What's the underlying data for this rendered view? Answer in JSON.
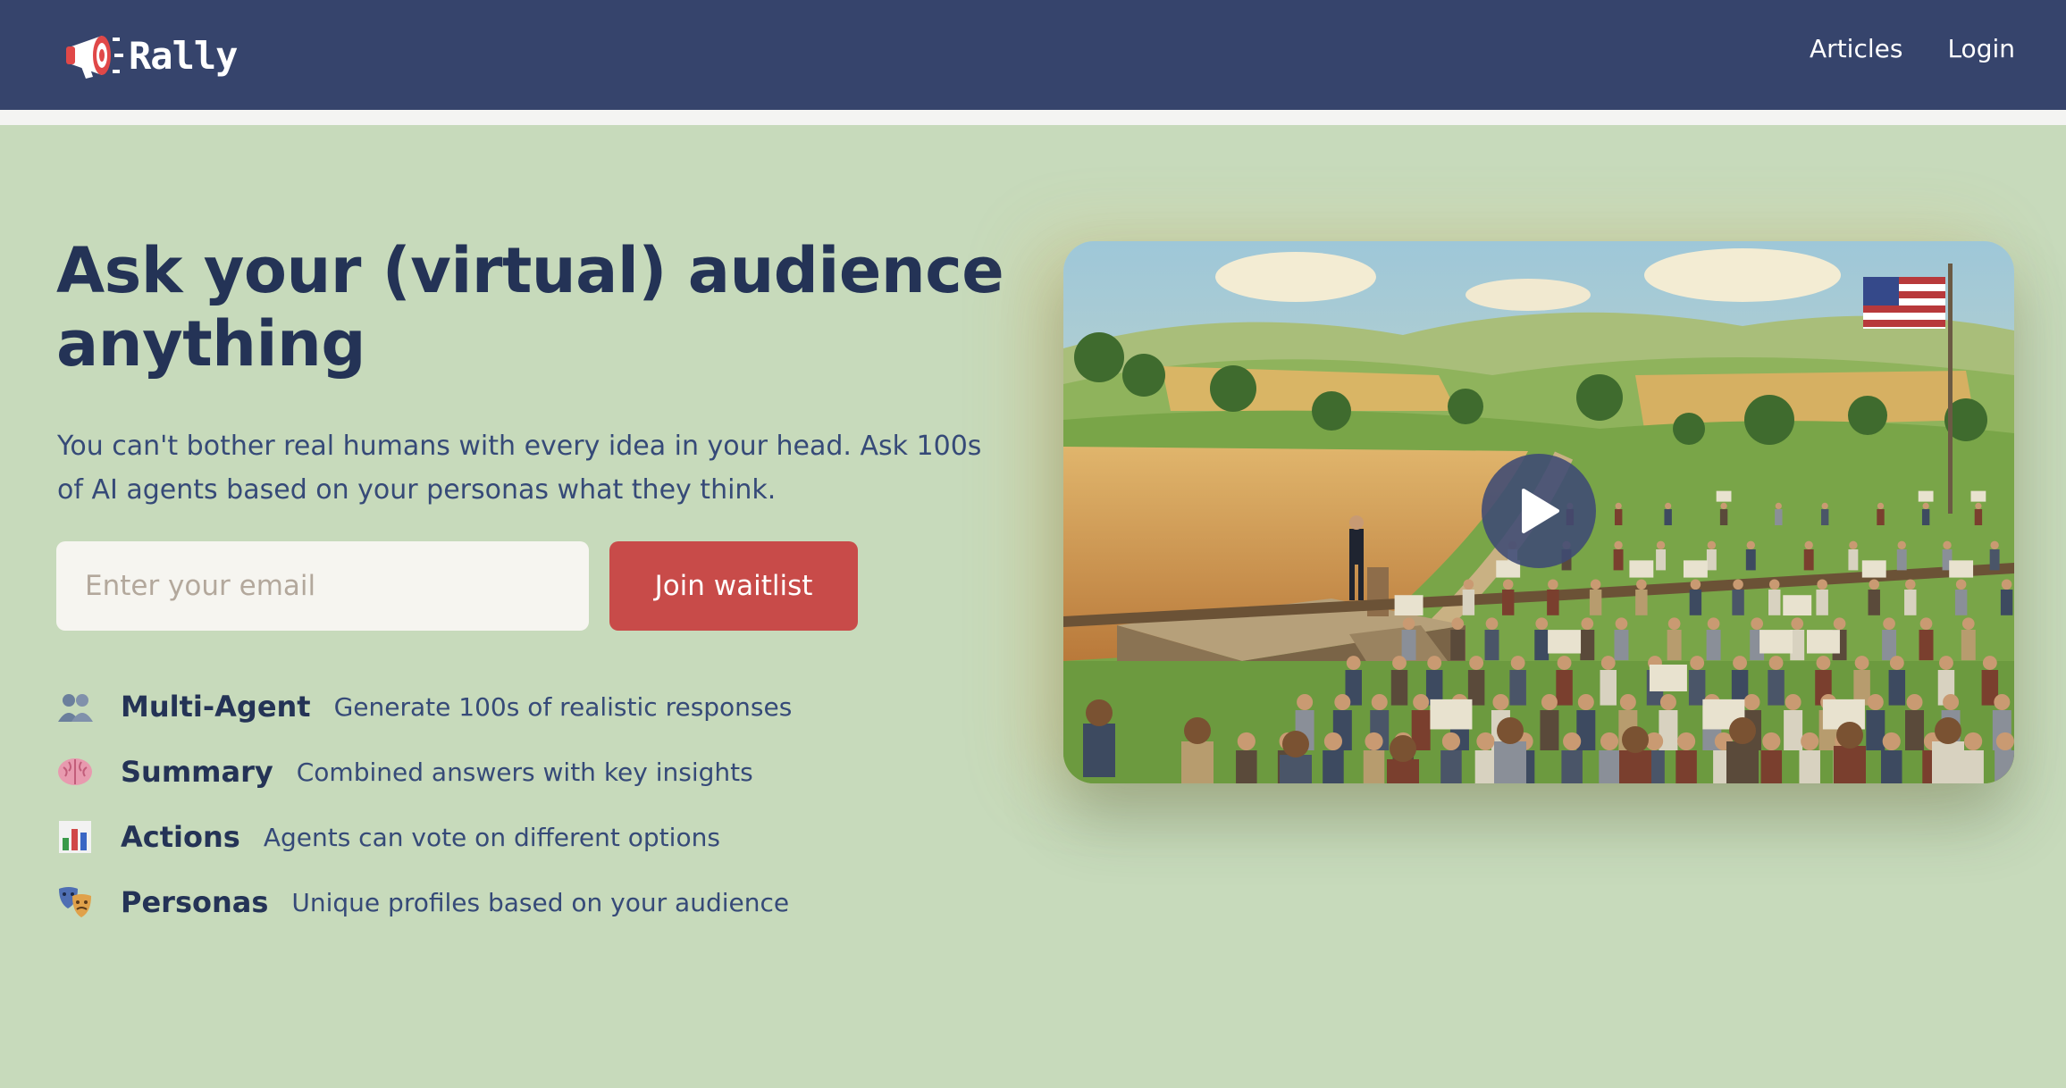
{
  "header": {
    "brand": "Rally",
    "nav": [
      "Articles",
      "Login"
    ]
  },
  "hero": {
    "title": "Ask your (virtual) audience anything",
    "subtitle": "You can't bother real humans with every idea in your head. Ask 100s of AI agents based on your personas what they think.",
    "email_placeholder": "Enter your email",
    "cta_label": "Join waitlist"
  },
  "features": [
    {
      "icon": "people-icon",
      "title": "Multi-Agent",
      "description": "Generate 100s of realistic responses"
    },
    {
      "icon": "brain-icon",
      "title": "Summary",
      "description": "Combined answers with key insights"
    },
    {
      "icon": "bar-chart-icon",
      "title": "Actions",
      "description": "Agents can vote on different options"
    },
    {
      "icon": "theater-masks-icon",
      "title": "Personas",
      "description": "Unique profiles based on your audience"
    }
  ],
  "video": {
    "play_icon": "play-icon"
  },
  "colors": {
    "nav_bg": "#36446c",
    "page_bg": "#c7dabb",
    "accent": "#c84b49",
    "heading": "#243356"
  }
}
